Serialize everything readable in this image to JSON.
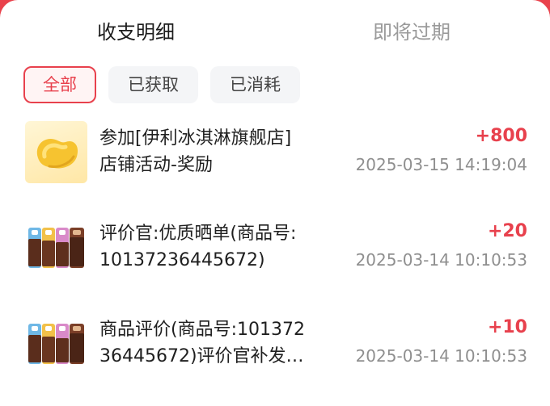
{
  "tabs": {
    "active": "收支明细",
    "inactive": "即将过期"
  },
  "filters": [
    "全部",
    "已获取",
    "已消耗"
  ],
  "records": [
    {
      "title_line1": "参加[伊利冰淇淋旗舰店]",
      "title_line2": "店铺活动-奖励",
      "amount": "+800",
      "time": "2025-03-15 14:19:04",
      "icon": "coin-bean-icon"
    },
    {
      "title_line1": "评价官:优质晒单(商品号:",
      "title_line2": "10137236445672)",
      "amount": "+20",
      "time": "2025-03-14 10:10:53",
      "icon": "ice-cream-product-icon"
    },
    {
      "title_line1": "商品评价(商品号:101372",
      "title_line2": "36445672)评价官补发…",
      "amount": "+10",
      "time": "2025-03-14 10:10:53",
      "icon": "ice-cream-product-icon"
    }
  ],
  "colors": {
    "accent": "#e8414d",
    "background": "#e9424c"
  }
}
